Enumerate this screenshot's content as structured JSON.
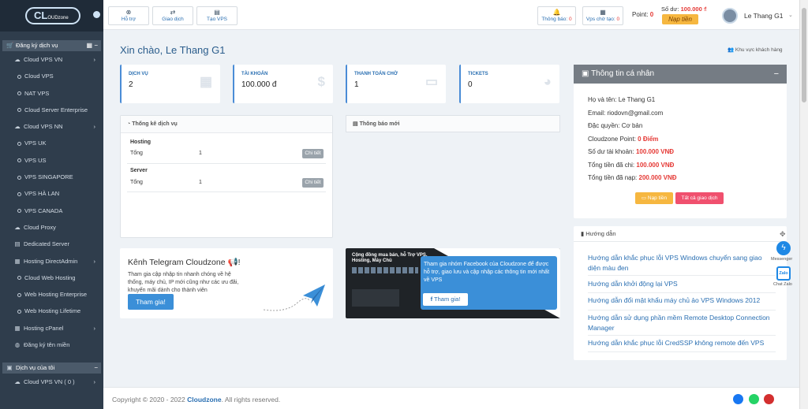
{
  "logo": {
    "text": "OUDzone",
    "prefix": "CL"
  },
  "sidebar": {
    "sec1": "Đăng ký dịch vụ",
    "items": [
      {
        "label": "Cloud VPS VN",
        "level": 1,
        "icon": "cloud-icon",
        "chev": true
      },
      {
        "label": "Cloud VPS",
        "level": 2
      },
      {
        "label": "NAT VPS",
        "level": 2
      },
      {
        "label": "Cloud Server Enterprise",
        "level": 2
      },
      {
        "label": "Cloud VPS NN",
        "level": 1,
        "icon": "cloud-icon",
        "chev": true
      },
      {
        "label": "VPS UK",
        "level": 2
      },
      {
        "label": "VPS US",
        "level": 2
      },
      {
        "label": "VPS SINGAPORE",
        "level": 2
      },
      {
        "label": "VPS HÀ LAN",
        "level": 2
      },
      {
        "label": "VPS CANADA",
        "level": 2
      },
      {
        "label": "Cloud Proxy",
        "level": 1,
        "icon": "cloud-icon"
      },
      {
        "label": "Dedicated Server",
        "level": 1,
        "icon": "server-icon"
      },
      {
        "label": "Hosting DirectAdmin",
        "level": 1,
        "icon": "hosting-icon",
        "chev": true
      },
      {
        "label": "Cloud Web Hosting",
        "level": 2
      },
      {
        "label": "Web Hosting Enterprise",
        "level": 2
      },
      {
        "label": "Web Hosting Lifetime",
        "level": 2
      },
      {
        "label": "Hosting cPanel",
        "level": 1,
        "icon": "hosting-icon",
        "chev": true
      },
      {
        "label": "Đăng ký tên miền",
        "level": 1,
        "icon": "globe-icon"
      }
    ],
    "sec2": "Dịch vụ của tôi",
    "my_items": [
      {
        "label": "Cloud VPS VN ( 0 )",
        "level": 1,
        "icon": "cloud-icon",
        "chev": true
      }
    ]
  },
  "topbar": {
    "support": "Hỗ trợ",
    "transactions": "Giao dịch",
    "create_vps": "Tạo VPS",
    "notif_label": "Thông báo:",
    "notif_count": "0",
    "pending_label": "Vps chờ tạo:",
    "pending_count": "0",
    "point_label": "Point:",
    "point_value": "0",
    "balance_label": "Số dư:",
    "balance_value": "100.000 ₫",
    "topup": "Nạp tiền",
    "user": "Le Thang G1"
  },
  "main": {
    "greeting": "Xin chào, Le Thang G1",
    "customer_area": "Khu vực khách hàng",
    "stats": [
      {
        "title": "DỊCH VỤ",
        "value": "2",
        "icon": "calendar-icon"
      },
      {
        "title": "TÀI KHOẢN",
        "value": "100.000 đ",
        "icon": "dollar-icon"
      },
      {
        "title": "THANH TOÁN CHỜ",
        "value": "1",
        "icon": "credit-card-icon"
      },
      {
        "title": "TICKETS",
        "value": "0",
        "icon": "comments-icon"
      }
    ],
    "service_stats": {
      "title": "Thống kê dịch vụ",
      "groups": [
        {
          "name": "Hosting",
          "label": "Tổng",
          "count": "1",
          "btn": "Chi tiết"
        },
        {
          "name": "Server",
          "label": "Tổng",
          "count": "1",
          "btn": "Chi tiết"
        }
      ]
    },
    "news": {
      "title": "Thông báo mới"
    },
    "telegram": {
      "title": "Kênh Telegram Cloudzone",
      "desc": "Tham gia cập nhập tin nhanh chóng về hệ thống, máy chủ, IP mới cũng như các ưu đãi, khuyến mãi dành cho thành viên",
      "btn": "Tham gia!"
    },
    "facebook": {
      "img_title": "Cộng đồng mua bán, hỗ Trợ VPS, Hosting, Máy Chủ",
      "desc": "Tham gia nhóm Facebook của Cloudzone để được hỗ trợ, giao lưu và cập nhập các thông tin mới nhất về VPS",
      "btn": "Tham gia!"
    }
  },
  "profile": {
    "title": "Thông tin cá nhân",
    "lines": [
      {
        "label": "Họ và tên:",
        "value": "Le Thang G1",
        "red": false
      },
      {
        "label": "Email:",
        "value": "riodovn@gmail.com",
        "red": false
      },
      {
        "label": "Đặc quyền:",
        "value": "Cơ bản",
        "red": false
      },
      {
        "label": "Cloudzone Point:",
        "value": "0 Điểm",
        "red": true
      },
      {
        "label": "Số dư tài khoản:",
        "value": "100.000 VNĐ",
        "red": true
      },
      {
        "label": "Tổng tiền đã chi:",
        "value": "100.000 VNĐ",
        "red": true
      },
      {
        "label": "Tổng tiền đã nạp:",
        "value": "200.000 VNĐ",
        "red": true
      }
    ],
    "topup_btn": "Nạp tiền",
    "all_tx_btn": "Tất cả giao dịch"
  },
  "guides": {
    "title": "Hướng dẫn",
    "items": [
      "Hướng dẫn khắc phục lỗi VPS Windows chuyển sang giao diện màu đen",
      "Hướng dẫn khởi động lại VPS",
      "Hướng dẫn đổi mật khẩu máy chủ ảo VPS Windows 2012",
      "Hướng dẫn sử dụng phần mềm Remote Desktop Connection Manager",
      "Hướng dẫn khắc phục lỗi CredSSP không remote đến VPS"
    ]
  },
  "floating": {
    "messenger": "Messenger",
    "zalo": "Chat Zalo",
    "zalo_logo": "Zalo"
  },
  "footer": {
    "copy": "Copyright © 2020 - 2022",
    "brand": "Cloudzone",
    "rights": ". All rights reserved."
  },
  "colors": {
    "sidebar": "#2f3d4c",
    "accent": "#2a6fb2",
    "red": "#e53935",
    "orange": "#f6b740",
    "pink": "#f0506e"
  }
}
